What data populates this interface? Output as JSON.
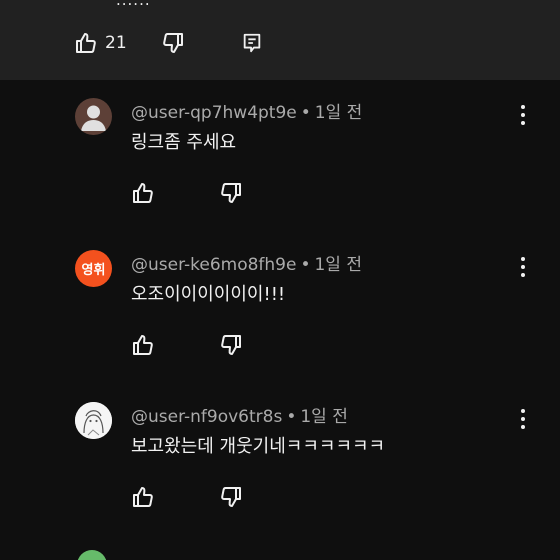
{
  "top_comment": {
    "clipped_text": "......",
    "like_count": "21"
  },
  "comments": [
    {
      "author": "@user-qp7hw4pt9e",
      "time": "1일 전",
      "text": "링크좀 주세요",
      "avatar_type": "person-silhouette"
    },
    {
      "author": "@user-ke6mo8fh9e",
      "time": "1일 전",
      "text": "오조이이이이이이!!!",
      "avatar_text": "영휘",
      "avatar_color": "#f4511e"
    },
    {
      "author": "@user-nf9ov6tr8s",
      "time": "1일 전",
      "text": "보고왔는데 개웃기네ㅋㅋㅋㅋㅋㅋ",
      "avatar_type": "anime-sketch"
    }
  ],
  "separator": "•",
  "colors": {
    "background": "#0f0f0f",
    "panel": "#212121",
    "text": "#f1f1f1",
    "meta": "#aaaaaa"
  }
}
